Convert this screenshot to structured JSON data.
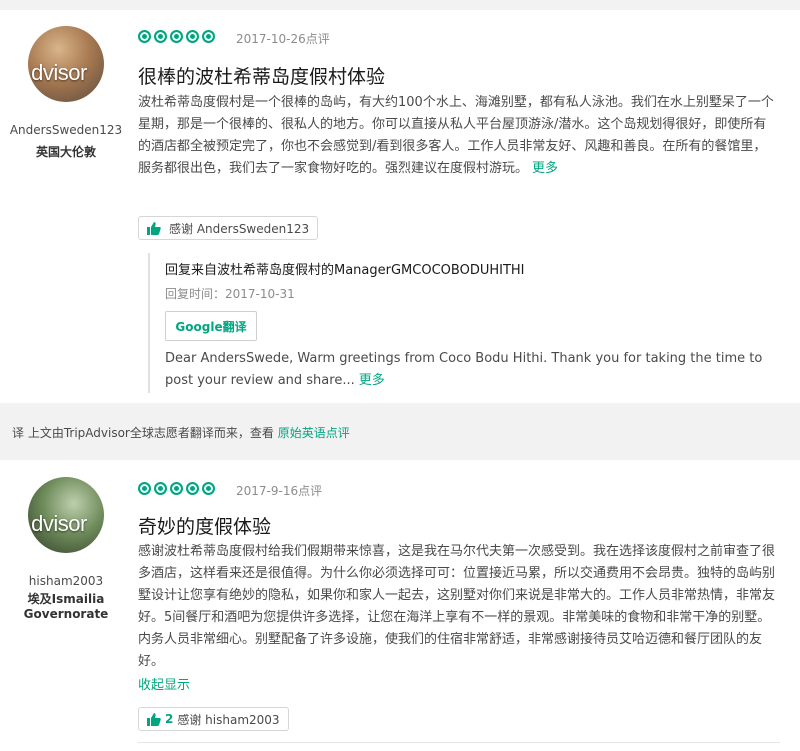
{
  "reviews": [
    {
      "avatar_text": "dvisor",
      "username": "AndersSweden123",
      "location": "英国大伦敦",
      "rating": 5,
      "date": "2017-10-26点评",
      "title": "很棒的波杜希蒂岛度假村体验",
      "body": "波杜希蒂岛度假村是一个很棒的岛屿，有大约100个水上、海滩别墅，都有私人泳池。我们在水上别墅呆了一个星期，那是一个很棒的、很私人的地方。你可以直接从私人平台屋顶游泳/潜水。这个岛规划得很好，即使所有的酒店都全被预定完了，你也不会感觉到/看到很多客人。工作人员非常友好、风趣和善良。在所有的餐馆里，服务都很出色，我们去了一家食物好吃的。强烈建议在度假村游玩。",
      "more_label": "更多",
      "thank_count": "",
      "thank_label": "感谢 AndersSweden123",
      "reply": {
        "header": "回复来自波杜希蒂岛度假村的ManagerGMCOCOBODUHITHI",
        "date": "回复时间：2017-10-31",
        "google_btn": "Google翻译",
        "body": "Dear AndersSwede, Warm greetings from Coco Bodu Hithi. Thank you for taking the time to post your review and share...",
        "more_label": "更多"
      }
    },
    {
      "avatar_text": "dvisor",
      "username": "hisham2003",
      "location": "埃及Ismailia Governorate",
      "rating": 5,
      "date": "2017-9-16点评",
      "title": "奇妙的度假体验",
      "body": "感谢波杜希蒂岛度假村给我们假期带来惊喜，这是我在马尔代夫第一次感受到。我在选择该度假村之前审查了很多酒店，这样看来还是很值得。为什么你必须选择可可：位置接近马累，所以交通费用不会昂贵。独特的岛屿别墅设计让您享有绝妙的隐私，如果你和家人一起去，这别墅对你们来说是非常大的。工作人员非常热情，非常友好。5间餐厅和酒吧为您提供许多选择，让您在海洋上享有不一样的景观。非常美味的食物和非常干净的别墅。内务人员非常细心。别墅配备了许多设施，使我们的住宿非常舒适，非常感谢接待员艾哈迈德和餐厅团队的友好。",
      "more_label": "收起显示",
      "thank_count": "2",
      "thank_label": "感谢 hisham2003"
    }
  ],
  "translate_bar": {
    "prefix": "译 上文由TripAdvisor全球志愿者翻译而来，查看",
    "link": "原始英语点评"
  },
  "colors": {
    "accent": "#00a680",
    "text": "#4a4a4a",
    "muted": "#8c8c8c",
    "background_strip": "#f2f2f2"
  },
  "icons": {
    "rating": "bubble-rating-icon",
    "thank": "thumbs-up-icon"
  }
}
